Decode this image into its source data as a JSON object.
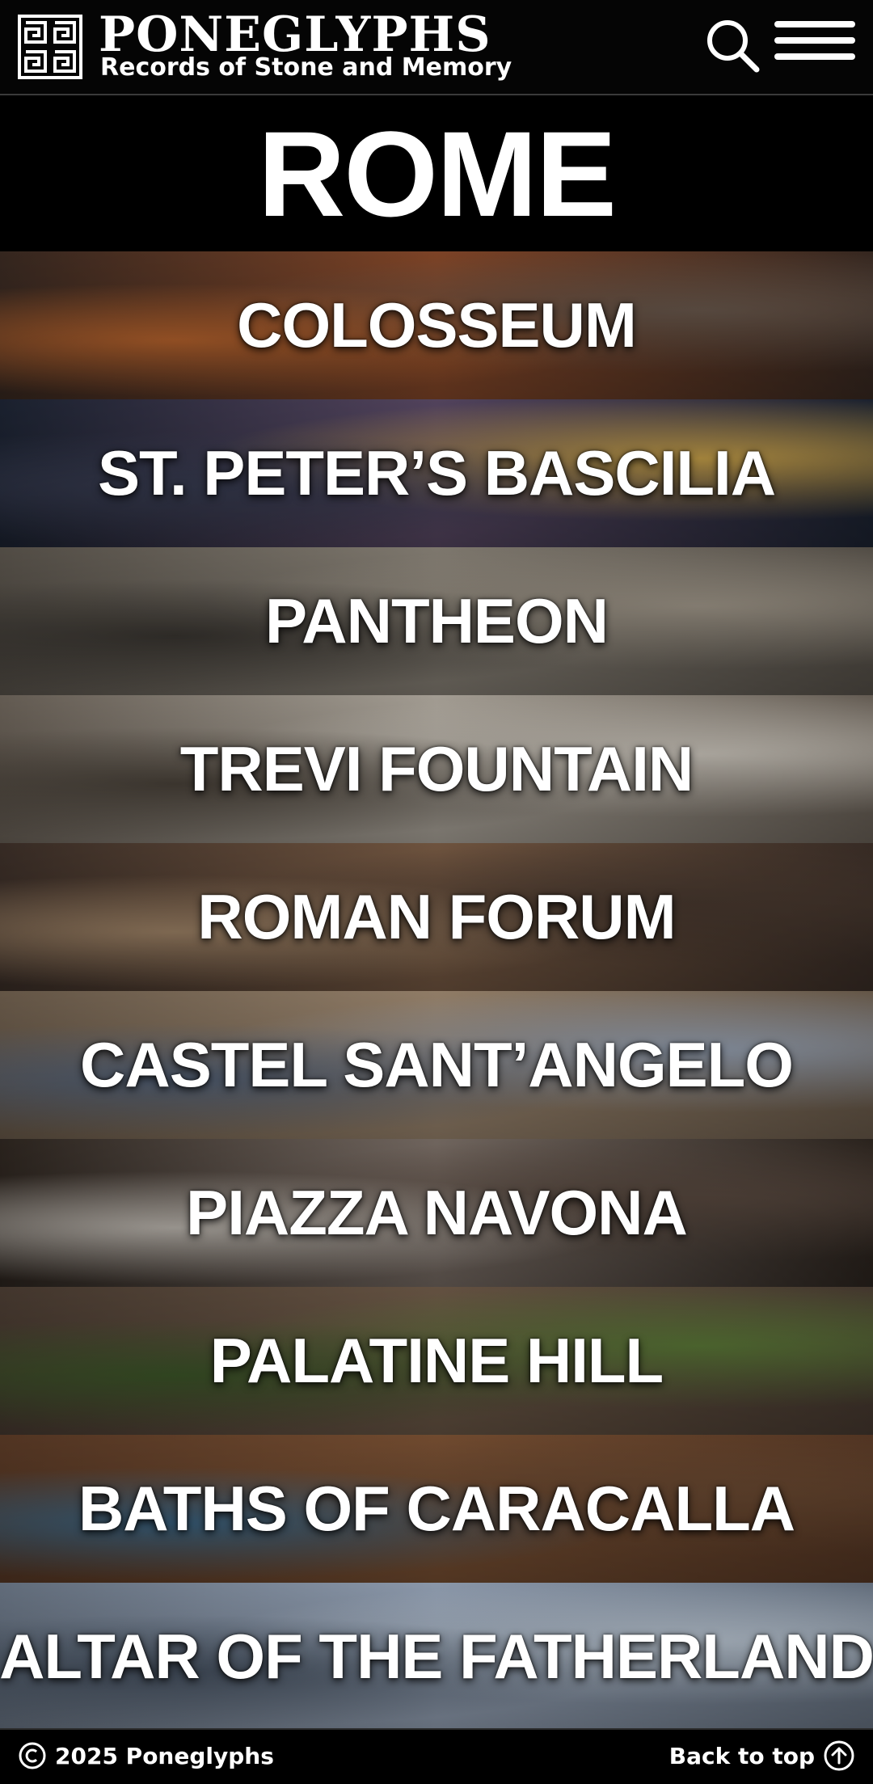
{
  "header": {
    "brand_name": "PONEGLYPHS",
    "tagline": "Records of Stone and Memory",
    "logo_icon": "glyph-grid-logo",
    "search_icon": "search-icon",
    "menu_icon": "hamburger-menu-icon"
  },
  "page": {
    "city": "ROME"
  },
  "landmarks": [
    {
      "label": "COLOSSEUM",
      "colors": [
        "#3a2a22",
        "#8a4a2a",
        "#c0682f",
        "#6b5a4e"
      ]
    },
    {
      "label": "ST. PETER’S BASCILIA",
      "colors": [
        "#1d2433",
        "#5b4a66",
        "#3a3f55",
        "#c9a24a"
      ]
    },
    {
      "label": "PANTHEON",
      "colors": [
        "#5a544c",
        "#8c857a",
        "#3c3833",
        "#a39a8c"
      ]
    },
    {
      "label": "TREVI FOUNTAIN",
      "colors": [
        "#6e655b",
        "#b5aea3",
        "#4e463d",
        "#d2ccc2"
      ]
    },
    {
      "label": "ROMAN FORUM",
      "colors": [
        "#3c2f28",
        "#7a5c45",
        "#a78a6c",
        "#4a3a30"
      ]
    },
    {
      "label": "CASTEL SANT’ANGELO",
      "colors": [
        "#6f5f4e",
        "#a08a72",
        "#5a6a82",
        "#9aa6b8"
      ]
    },
    {
      "label": "PIAZZA NAVONA",
      "colors": [
        "#2e2620",
        "#7c7068",
        "#c9c3bb",
        "#5a4a40"
      ]
    },
    {
      "label": "PALATINE HILL",
      "colors": [
        "#4a3c32",
        "#6e5a48",
        "#3f5a2a",
        "#5c7a38"
      ]
    },
    {
      "label": "BATHS OF CARACALLA",
      "colors": [
        "#5a3a26",
        "#7c5234",
        "#3f6a8a",
        "#6b4a32"
      ]
    },
    {
      "label": "ALTAR OF THE FATHERLAND",
      "colors": [
        "#6c7888",
        "#9aa8bc",
        "#4a5666",
        "#c0ccd9"
      ]
    }
  ],
  "footer": {
    "copyright": "2025 Poneglyphs",
    "back_to_top": "Back to top",
    "copyright_icon": "copyright-icon",
    "back_icon": "arrow-up-circle-icon"
  }
}
